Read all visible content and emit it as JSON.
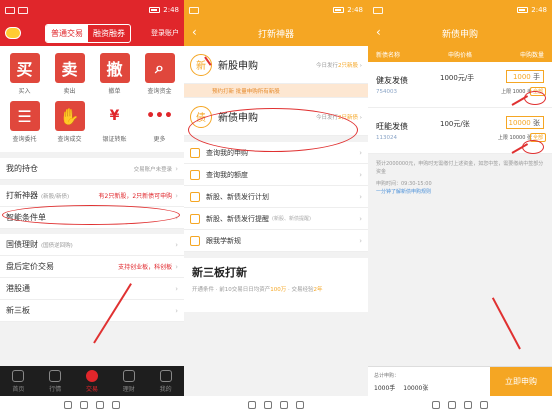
{
  "p1": {
    "status_time": "2:48",
    "tabs": [
      "普通交易",
      "融资融券"
    ],
    "login": "登录账户",
    "grid": [
      {
        "glyph": "买",
        "label": "买入",
        "style": "red",
        "icon": "buy-icon"
      },
      {
        "glyph": "卖",
        "label": "卖出",
        "style": "red",
        "icon": "sell-icon"
      },
      {
        "glyph": "撤",
        "label": "撤单",
        "style": "red",
        "icon": "cancel-order-icon"
      },
      {
        "glyph": "⌕",
        "label": "查询资金",
        "style": "red",
        "icon": "search-icon"
      },
      {
        "glyph": "☰",
        "label": "查询委托",
        "style": "red",
        "icon": "document-icon"
      },
      {
        "glyph": "✋",
        "label": "查询成交",
        "style": "red",
        "icon": "handshake-icon"
      },
      {
        "glyph": "¥",
        "label": "银证转账",
        "style": "out",
        "icon": "yuan-icon"
      },
      {
        "glyph": "•••",
        "label": "更多",
        "style": "out",
        "icon": "more-icon"
      }
    ],
    "holdings": {
      "label": "我的持仓",
      "note": "交易账户未登录"
    },
    "daxin": {
      "label": "打新神器",
      "note": "(新股/新债)",
      "tag": "有2只新股，2只新债可申购"
    },
    "smart": {
      "label": "智能条件单"
    },
    "guozhai": {
      "label": "国债理财",
      "note": "(国债逆回购)"
    },
    "panhou": {
      "label": "盘后定价交易",
      "tag": "支持创业板，科创板"
    },
    "ganggu": {
      "label": "港股通"
    },
    "sanban": {
      "label": "新三板"
    },
    "tabbar": [
      "首页",
      "行情",
      "交易",
      "理财",
      "我的"
    ]
  },
  "p2": {
    "status_time": "2:48",
    "title": "打新神器",
    "ipo": {
      "title": "新股申购",
      "sub": "今日发行",
      "count": "2只新股"
    },
    "banner": "预约打新 批量申购所有新股",
    "bond": {
      "title": "新债申购",
      "sub": "今日发行",
      "count": "2只新债"
    },
    "rows": [
      {
        "label": "查询我的申购",
        "note": ""
      },
      {
        "label": "查询我的额度",
        "note": ""
      },
      {
        "label": "新股、新债发行计划",
        "note": ""
      },
      {
        "label": "新股、新债发行提醒",
        "note": "(新股、新债提醒)"
      },
      {
        "label": "跟我学新规",
        "note": ""
      }
    ],
    "sanban": {
      "title": "新三板打新",
      "desc": "开通条件 · 前10交易日日均资产",
      "amt": "100万",
      "desc2": " · 交易经验",
      "years": "2年"
    }
  },
  "p3": {
    "status_time": "2:48",
    "title": "新债申购",
    "cols": [
      "新债名称",
      "申购价格",
      "申购数量"
    ],
    "bonds": [
      {
        "name": "健友发债",
        "code": "754003",
        "price": "1000元/手",
        "qty": "1000",
        "unit": "手",
        "limit": "上限 1000 手",
        "all": "全部"
      },
      {
        "name": "旺能发债",
        "code": "113024",
        "price": "100元/张",
        "qty": "10000",
        "unit": "张",
        "limit": "上限 10000 张",
        "all": "全部"
      }
    ],
    "info": "预计2000000元，申购时无需缴付上述资金，如您中签，需要缴纳中签部分资金",
    "time": "申购时间：09:30-15:00",
    "link": "一分钟了解新债申购规则",
    "summary_label": "总计申购：",
    "summary": [
      "1000手",
      "10000张"
    ],
    "button": "立即申购"
  }
}
